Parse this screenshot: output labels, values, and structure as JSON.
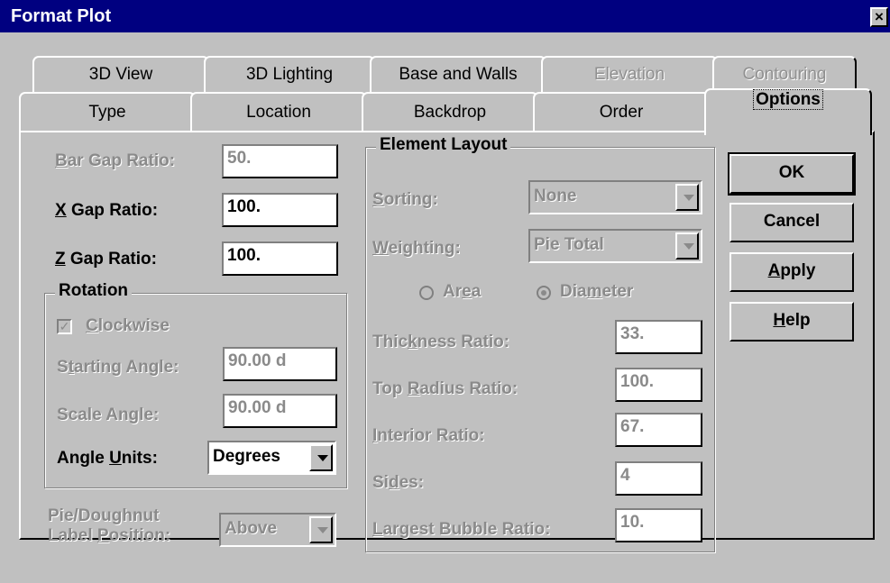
{
  "window": {
    "title": "Format Plot",
    "close_glyph": "×"
  },
  "tabs_back": [
    "3D View",
    "3D Lighting",
    "Base and Walls",
    "Elevation",
    "Contouring"
  ],
  "tabs_front": [
    "Type",
    "Location",
    "Backdrop",
    "Order",
    "Options"
  ],
  "left": {
    "bar_gap": {
      "pre": "",
      "u": "B",
      "post": "ar Gap Ratio:",
      "value": "50."
    },
    "x_gap": {
      "pre": "",
      "u": "X",
      "post": " Gap Ratio:",
      "value": "100."
    },
    "z_gap": {
      "pre": "",
      "u": "Z",
      "post": " Gap Ratio:",
      "value": "100."
    },
    "rotation": {
      "title": "Rotation",
      "clockwise": {
        "pre": "",
        "u": "C",
        "post": "lockwise",
        "check": "✓"
      },
      "starting_angle": {
        "pre": "S",
        "u": "t",
        "post": "arting Angle:",
        "value": "90.00 d"
      },
      "scale_angle": {
        "label": "Scale Angle:",
        "value": "90.00 d"
      },
      "angle_units": {
        "pre": "Angle ",
        "u": "U",
        "post": "nits:",
        "value": "Degrees"
      }
    },
    "pie_label": {
      "line1": "Pie/Doughnut",
      "line2_pre": "Label ",
      "line2_u": "P",
      "line2_post": "osition:",
      "value": "Above"
    }
  },
  "element_layout": {
    "title": "Element Layout",
    "sorting": {
      "pre": "",
      "u": "S",
      "post": "orting:",
      "value": "None"
    },
    "weighting": {
      "pre": "",
      "u": "W",
      "post": "eighting:",
      "value": "Pie Total"
    },
    "area": {
      "pre": "Ar",
      "u": "e",
      "post": "a"
    },
    "diameter": {
      "pre": "Dia",
      "u": "m",
      "post": "eter"
    },
    "thickness": {
      "pre": "Thic",
      "u": "k",
      "post": "ness Ratio:",
      "value": "33."
    },
    "top_radius": {
      "pre": "Top ",
      "u": "R",
      "post": "adius Ratio:",
      "value": "100."
    },
    "interior": {
      "pre": "",
      "u": "I",
      "post": "nterior Ratio:",
      "value": "67."
    },
    "sides": {
      "pre": "Si",
      "u": "d",
      "post": "es:",
      "value": "4"
    },
    "largest_bubble": {
      "pre": "",
      "u": "L",
      "post": "argest Bubble Ratio:",
      "value": "10."
    }
  },
  "buttons": {
    "ok": {
      "pre": "OK",
      "u": "",
      "post": ""
    },
    "cancel": {
      "pre": "Cancel",
      "u": "",
      "post": ""
    },
    "apply": {
      "pre": "",
      "u": "A",
      "post": "pply"
    },
    "help": {
      "pre": "",
      "u": "H",
      "post": "elp"
    }
  }
}
